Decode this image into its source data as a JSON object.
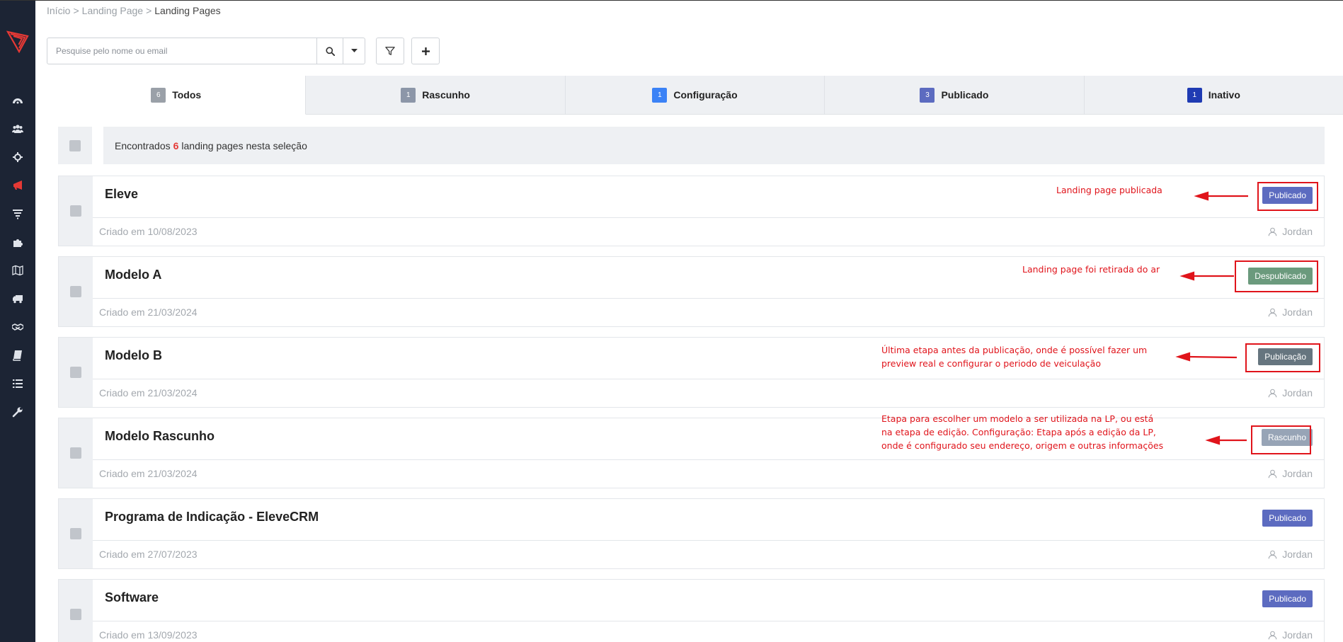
{
  "sidebar": {
    "logo": "elevecrm-logo",
    "items": [
      {
        "icon": "dashboard-icon"
      },
      {
        "icon": "users-icon"
      },
      {
        "icon": "crosshair-icon"
      },
      {
        "icon": "megaphone-icon",
        "active": true
      },
      {
        "icon": "funnel-icon"
      },
      {
        "icon": "puzzle-icon"
      },
      {
        "icon": "map-icon"
      },
      {
        "icon": "truck-icon"
      },
      {
        "icon": "handshake-icon"
      },
      {
        "icon": "book-icon"
      },
      {
        "icon": "list-icon"
      },
      {
        "icon": "wrench-icon"
      }
    ]
  },
  "breadcrumb": {
    "items": [
      "Início",
      "Landing Page"
    ],
    "separator": ">",
    "current": "Landing Pages"
  },
  "search": {
    "placeholder": "Pesquise pelo nome ou email",
    "value": ""
  },
  "tabs": [
    {
      "count": "6",
      "label": "Todos",
      "color": "#9aa0a8",
      "active": true
    },
    {
      "count": "1",
      "label": "Rascunho",
      "color": "#8c96a8"
    },
    {
      "count": "1",
      "label": "Configuração",
      "color": "#3b82f6"
    },
    {
      "count": "3",
      "label": "Publicado",
      "color": "#5c6bc0"
    },
    {
      "count": "1",
      "label": "Inativo",
      "color": "#1f3bb3"
    }
  ],
  "summary": {
    "prefix": "Encontrados",
    "count": "6",
    "suffix": "landing pages nesta seleção"
  },
  "cards": [
    {
      "title": "Eleve",
      "date": "Criado em 10/08/2023",
      "user": "Jordan",
      "status": "Publicado",
      "status_color": "#5c6bc0"
    },
    {
      "title": "Modelo A",
      "date": "Criado em 21/03/2024",
      "user": "Jordan",
      "status": "Despublicado",
      "status_color": "#6b9a7d"
    },
    {
      "title": "Modelo B",
      "date": "Criado em 21/03/2024",
      "user": "Jordan",
      "status": "Publicação",
      "status_color": "#66757f"
    },
    {
      "title": "Modelo Rascunho",
      "date": "Criado em 21/03/2024",
      "user": "Jordan",
      "status": "Rascunho",
      "status_color": "#97a4b6"
    },
    {
      "title": "Programa de Indicação - EleveCRM",
      "date": "Criado em 27/07/2023",
      "user": "Jordan",
      "status": "Publicado",
      "status_color": "#5c6bc0"
    },
    {
      "title": "Software",
      "date": "Criado em 13/09/2023",
      "user": "Jordan",
      "status": "Publicado",
      "status_color": "#5c6bc0"
    }
  ],
  "annotations": {
    "a1": [
      "Landing page publicada"
    ],
    "a2": [
      "Landing page foi retirada do ar"
    ],
    "a3": [
      "Última etapa antes da publicação, onde é possível fazer um",
      "preview real e configurar o periodo de veiculação"
    ],
    "a4": [
      "Etapa para escolher um modelo a ser utilizada na LP, ou está",
      "na etapa de edição. Configuração: Etapa após a edição da LP,",
      "onde é configurado seu endereço, origem e outras informações"
    ],
    "color": "#e0141b"
  }
}
